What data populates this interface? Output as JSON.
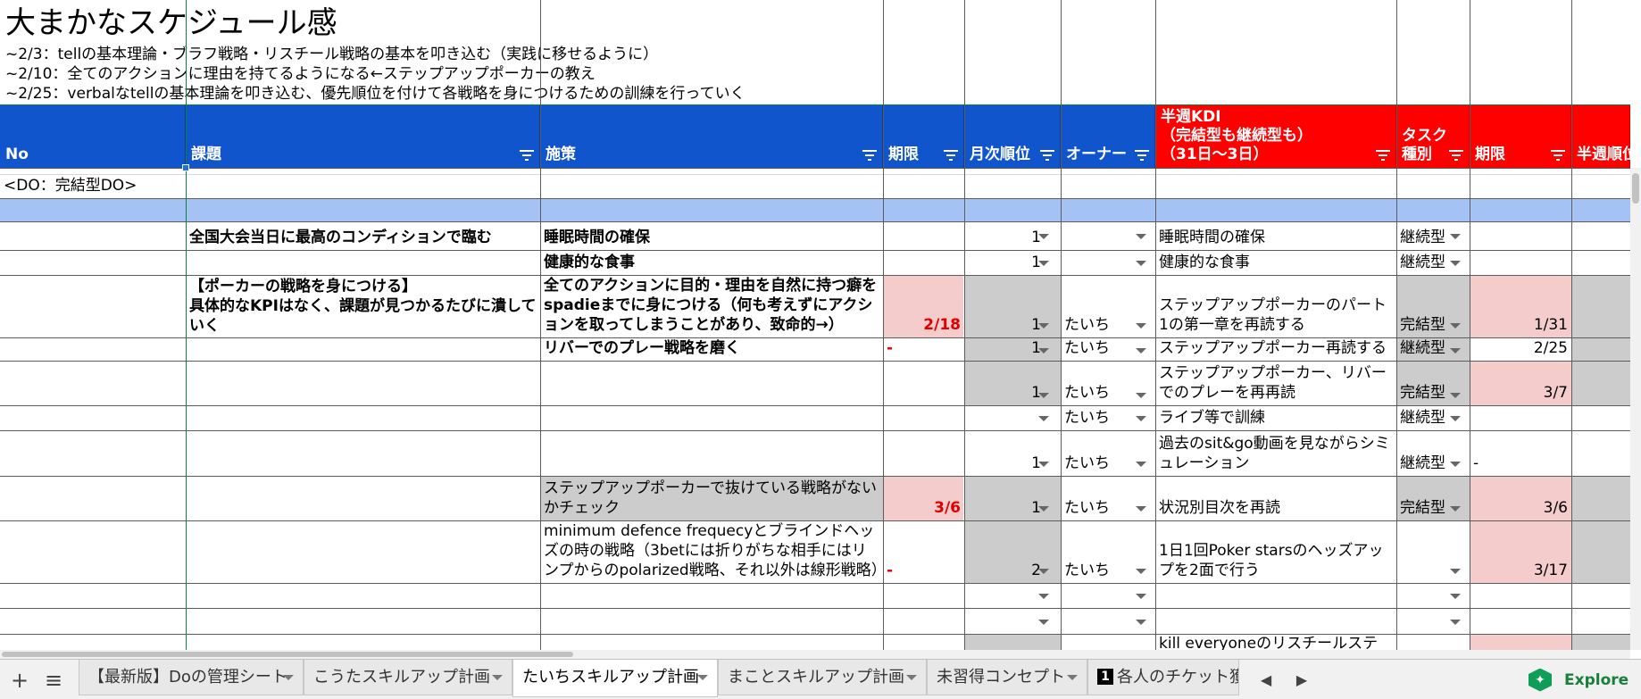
{
  "sheet_title": "大まかなスケジュール感",
  "schedule_lines": [
    "~2/3：tellの基本理論・ブラフ戦略・リスチール戦略の基本を叩き込む（実践に移せるように）",
    "~2/10：全てのアクションに理由を持てるようになる←ステップアップポーカーの教え",
    "~2/25：verbalなtellの基本理論を叩き込む、優先順位を付けて各戦略を身につけるための訓練を行っていく"
  ],
  "headers": {
    "no": "No",
    "kadai": "課題",
    "shisaku": "施策",
    "kigen": "期限",
    "getsuji": "月次順位",
    "owner": "オーナー",
    "kdi": "半週KDI\n（完結型も継続型も）\n（31日〜3日）",
    "task_type": "タスク\n種別",
    "kigen2": "期限",
    "hanshu": "半週順位"
  },
  "section_label": "<DO：完結型DO>",
  "rows": [
    {
      "kadai": "全国大会当日に最高のコンディションで臨む",
      "shisaku": "睡眠時間の確保",
      "kigen": "",
      "rank": "1",
      "owner": "",
      "kdi": "睡眠時間の確保",
      "type": "継続型",
      "kigen2": ""
    },
    {
      "kadai": "",
      "shisaku": "健康的な食事",
      "kigen": "",
      "rank": "1",
      "owner": "",
      "kdi": "健康的な食事",
      "type": "継続型",
      "kigen2": ""
    },
    {
      "kadai": "【ポーカーの戦略を身につける】\n具体的なKPIはなく、課題が見つかるたびに潰していく",
      "shisaku": "全てのアクションに目的・理由を自然に持つ癖をspadieまでに身につける（何も考えずにアクションを取ってしまうことがあり、致命的→）",
      "kigen": "2/18",
      "rank": "1",
      "owner": "たいち",
      "kdi": "ステップアップポーカーのパート1の第一章を再読する",
      "type": "完結型",
      "kigen2": "1/31"
    },
    {
      "kadai": "",
      "shisaku": "リバーでのプレー戦略を磨く",
      "kigen": "-",
      "rank": "1",
      "owner": "たいち",
      "kdi": "ステップアップポーカー再読する",
      "type": "継続型",
      "kigen2": "2/25"
    },
    {
      "kadai": "",
      "shisaku": "",
      "kigen": "",
      "rank": "1",
      "owner": "たいち",
      "kdi": "ステップアップポーカー、リバーでのプレーを再再読",
      "type": "完結型",
      "kigen2": "3/7"
    },
    {
      "kadai": "",
      "shisaku": "",
      "kigen": "",
      "rank": "",
      "owner": "たいち",
      "kdi": "ライブ等で訓練",
      "type": "継続型",
      "kigen2": ""
    },
    {
      "kadai": "",
      "shisaku": "",
      "kigen": "",
      "rank": "1",
      "owner": "たいち",
      "kdi": "過去のsit&go動画を見ながらシミュレーション",
      "type": "継続型",
      "kigen2": "-"
    },
    {
      "kadai": "",
      "shisaku": "ステップアップポーカーで抜けている戦略がないかチェック",
      "kigen": "3/6",
      "rank": "1",
      "owner": "たいち",
      "kdi": "状況別目次を再読",
      "type": "完結型",
      "kigen2": "3/6"
    },
    {
      "kadai": "",
      "shisaku": "minimum defence frequecyとブラインドヘッズの時の戦略（3betには折りがちな相手にはリンプからのpolarized戦略、それ以外は線形戦略）",
      "kigen": "-",
      "rank": "2",
      "owner": "たいち",
      "kdi": "1日1回Poker starsのヘッズアップを2面で行う",
      "type": "",
      "kigen2": "3/17"
    },
    {
      "kdi_partial": "kill everyoneのリスチールステー"
    }
  ],
  "tabs": [
    {
      "label": "【最新版】Doの管理シート",
      "active": false
    },
    {
      "label": "こうたスキルアップ計画",
      "active": false
    },
    {
      "label": "たいちスキルアップ計画",
      "active": true
    },
    {
      "label": "まことスキルアップ計画",
      "active": false
    },
    {
      "label": "未習得コンセプト",
      "active": false
    },
    {
      "label": "各人のチケット獲",
      "badge": "1",
      "active": false
    }
  ],
  "toolbar": {
    "add": "+",
    "menu": "≡",
    "prev": "◀",
    "next": "▶",
    "explore": "Explore"
  },
  "colors": {
    "header_blue": "#1155cc",
    "header_red": "#ff0000",
    "gray_cell": "#cccccc",
    "pink_cell": "#f4cccc",
    "section_blue": "#a4c2f4"
  }
}
